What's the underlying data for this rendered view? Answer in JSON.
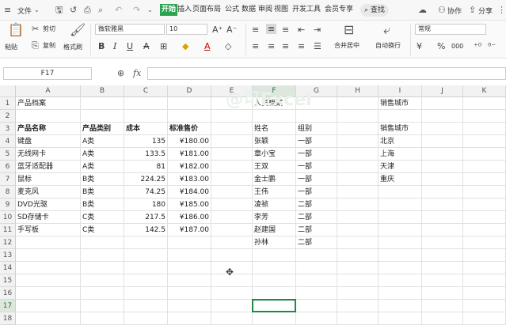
{
  "menubar": {
    "file_label": "文件",
    "tabs": [
      "开始",
      "插入",
      "页面布局",
      "公式",
      "数据",
      "审阅",
      "视图",
      "开发工具",
      "会员专享"
    ],
    "active_tab": "开始",
    "search_label": "查找",
    "collab_label": "协作",
    "share_label": "分享"
  },
  "ribbon": {
    "paste_label": "粘贴",
    "cut_label": "剪切",
    "copy_label": "复制",
    "format_painter_label": "格式刷",
    "font_name": "微软雅黑",
    "font_size": "10",
    "merge_label": "合并居中",
    "wrap_label": "自动换行",
    "number_format": "常规",
    "percent_label": "%",
    "decimals_label": "000",
    "currency_label": "¥",
    "bold_label": "B",
    "italic_label": "I",
    "underline_label": "U",
    "strike_label": "A",
    "grow_font_label": "A⁺",
    "shrink_font_label": "A⁻"
  },
  "formula_bar": {
    "name_box": "F17",
    "fx_label": "fx",
    "formula": ""
  },
  "columns": [
    "A",
    "B",
    "C",
    "D",
    "E",
    "F",
    "G",
    "H",
    "I",
    "J",
    "K"
  ],
  "selected_column": "F",
  "rows": [
    "1",
    "2",
    "3",
    "4",
    "5",
    "6",
    "7",
    "8",
    "9",
    "10",
    "11",
    "12",
    "13",
    "14",
    "15",
    "16",
    "17",
    "18"
  ],
  "selected_row": "17",
  "cells": {
    "A1": "产品档案",
    "A3": "产品名称",
    "B3": "产品类别",
    "C3": "成本",
    "D3": "标准售价",
    "A4": "键盘",
    "B4": "A类",
    "C4": "135",
    "D4": "¥180.00",
    "A5": "无线网卡",
    "B5": "A类",
    "C5": "133.5",
    "D5": "¥181.00",
    "A6": "蓝牙适配器",
    "B6": "A类",
    "C6": "81",
    "D6": "¥182.00",
    "A7": "鼠标",
    "B7": "B类",
    "C7": "224.25",
    "D7": "¥183.00",
    "A8": "麦克风",
    "B8": "B类",
    "C8": "74.25",
    "D8": "¥184.00",
    "A9": "DVD光驱",
    "B9": "B类",
    "C9": "180",
    "D9": "¥185.00",
    "A10": "SD存储卡",
    "B10": "C类",
    "C10": "217.5",
    "D10": "¥186.00",
    "A11": "手写板",
    "B11": "C类",
    "C11": "142.5",
    "D11": "¥187.00",
    "F1": "人员档案",
    "F3": "姓名",
    "G3": "组别",
    "F4": "张颖",
    "G4": "一部",
    "F5": "章小宝",
    "G5": "一部",
    "F6": "王双",
    "G6": "一部",
    "F7": "金士鹏",
    "G7": "一部",
    "F8": "王伟",
    "G8": "一部",
    "F9": "凌祯",
    "G9": "二部",
    "F10": "李芳",
    "G10": "二部",
    "F11": "赵建国",
    "G11": "二部",
    "F12": "孙林",
    "G12": "二部",
    "I1": "销售城市",
    "I3": "销售城市",
    "I4": "北京",
    "I5": "上海",
    "I6": "天津",
    "I7": "重庆"
  },
  "watermark": "@可Excel"
}
